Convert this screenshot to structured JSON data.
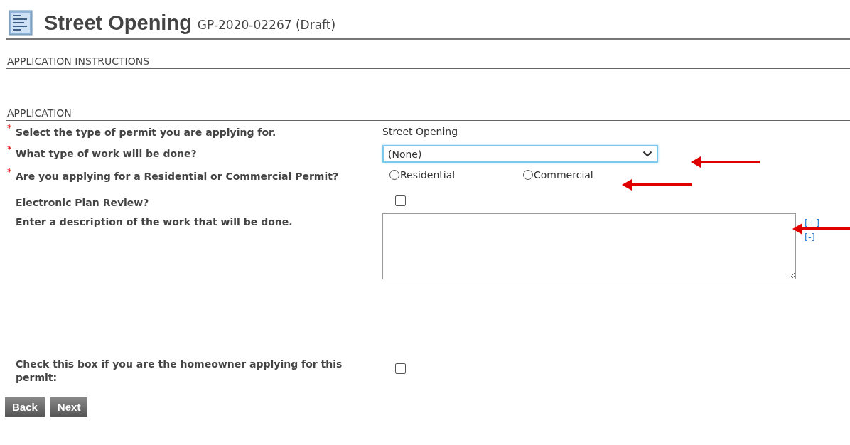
{
  "header": {
    "title": "Street Opening",
    "record": "GP-2020-02267 (Draft)"
  },
  "sections": [
    {
      "title": "APPLICATION INSTRUCTIONS"
    },
    {
      "title": "APPLICATION"
    }
  ],
  "fields": [
    {
      "kind": "static",
      "label": "Select the type of permit you are applying for.",
      "required_mark": "*",
      "value": "Street Opening"
    },
    {
      "kind": "select",
      "label": "What type of work will be done?",
      "required_mark": "*",
      "value": "(None)"
    },
    {
      "kind": "radio",
      "label": "Are you applying for a Residential or Commercial Permit?",
      "required_mark": "*",
      "options": [
        {
          "label": "Residential",
          "selected": false
        },
        {
          "label": "Commercial",
          "selected": false
        }
      ]
    },
    {
      "kind": "checkbox",
      "label": "Electronic Plan Review?",
      "checked": false
    },
    {
      "kind": "textarea",
      "label": "Enter a description of the work that will be done.",
      "links": [
        "[+]",
        "[-]"
      ]
    },
    {
      "kind": "checkbox",
      "label": "Check this box if you are the homeowner applying for this permit:",
      "checked": false
    }
  ],
  "buttons": [
    "Back",
    "Next"
  ]
}
